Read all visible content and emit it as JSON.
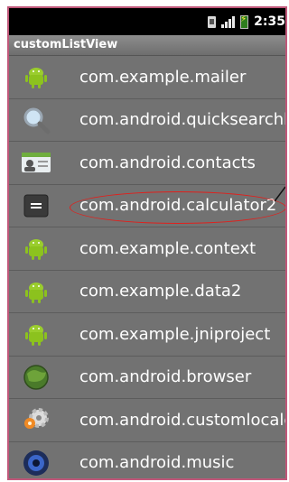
{
  "status_bar": {
    "time": "2:35",
    "icons": [
      "sim-icon",
      "signal-icon",
      "battery-charging-icon"
    ]
  },
  "app_title": "customListView",
  "list_items": [
    {
      "label": "com.example.mailer",
      "icon": "android-robot-icon"
    },
    {
      "label": "com.android.quicksearchbox",
      "icon": "magnifier-icon"
    },
    {
      "label": "com.android.contacts",
      "icon": "contacts-icon"
    },
    {
      "label": "com.android.calculator2",
      "icon": "calculator-icon",
      "highlighted": true
    },
    {
      "label": "com.example.context",
      "icon": "android-robot-icon"
    },
    {
      "label": "com.example.data2",
      "icon": "android-robot-icon"
    },
    {
      "label": "com.example.jniproject",
      "icon": "android-robot-icon"
    },
    {
      "label": "com.android.browser",
      "icon": "globe-icon"
    },
    {
      "label": "com.android.customlocale",
      "icon": "gear-icon"
    },
    {
      "label": "com.android.music",
      "icon": "speaker-icon"
    }
  ],
  "colors": {
    "highlight_outline": "#e0201c",
    "frame_border": "#c0587a",
    "list_background": "#727272"
  }
}
